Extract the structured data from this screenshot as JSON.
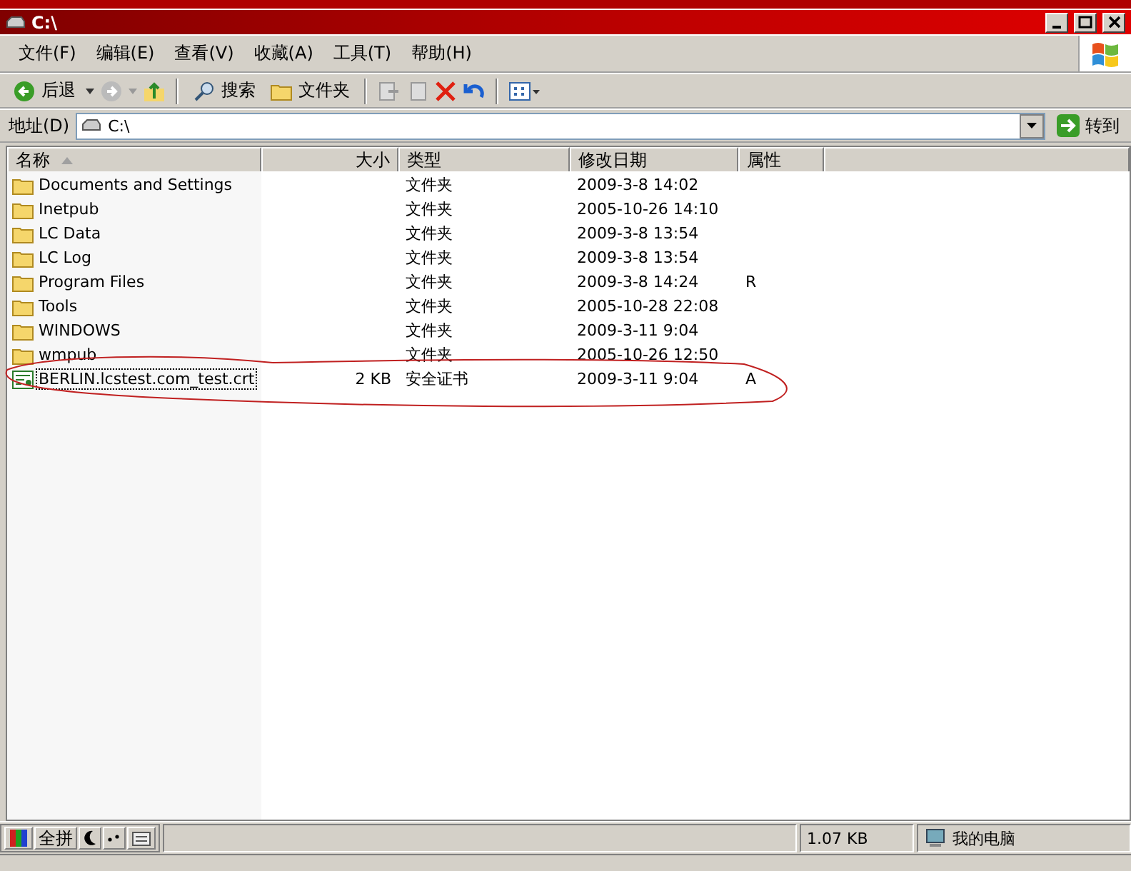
{
  "window": {
    "title": "C:\\"
  },
  "menu": [
    "文件(F)",
    "编辑(E)",
    "查看(V)",
    "收藏(A)",
    "工具(T)",
    "帮助(H)"
  ],
  "toolbar": {
    "back": "后退",
    "search": "搜索",
    "folders": "文件夹"
  },
  "address": {
    "label": "地址(D)",
    "value": "C:\\",
    "go": "转到"
  },
  "columns": [
    {
      "label": "名称",
      "sorted": true
    },
    {
      "label": "大小",
      "sorted": false
    },
    {
      "label": "类型",
      "sorted": false
    },
    {
      "label": "修改日期",
      "sorted": false
    },
    {
      "label": "属性",
      "sorted": false
    }
  ],
  "rows": [
    {
      "kind": "folder",
      "name": "Documents and Settings",
      "size": "",
      "type": "文件夹",
      "date": "2009-3-8 14:02",
      "attr": "",
      "focused": false
    },
    {
      "kind": "folder",
      "name": "Inetpub",
      "size": "",
      "type": "文件夹",
      "date": "2005-10-26 14:10",
      "attr": "",
      "focused": false
    },
    {
      "kind": "folder",
      "name": "LC Data",
      "size": "",
      "type": "文件夹",
      "date": "2009-3-8 13:54",
      "attr": "",
      "focused": false
    },
    {
      "kind": "folder",
      "name": "LC Log",
      "size": "",
      "type": "文件夹",
      "date": "2009-3-8 13:54",
      "attr": "",
      "focused": false
    },
    {
      "kind": "folder",
      "name": "Program Files",
      "size": "",
      "type": "文件夹",
      "date": "2009-3-8 14:24",
      "attr": "R",
      "focused": false
    },
    {
      "kind": "folder",
      "name": "Tools",
      "size": "",
      "type": "文件夹",
      "date": "2005-10-28 22:08",
      "attr": "",
      "focused": false
    },
    {
      "kind": "folder",
      "name": "WINDOWS",
      "size": "",
      "type": "文件夹",
      "date": "2009-3-11 9:04",
      "attr": "",
      "focused": false
    },
    {
      "kind": "folder",
      "name": "wmpub",
      "size": "",
      "type": "文件夹",
      "date": "2005-10-26 12:50",
      "attr": "",
      "focused": false
    },
    {
      "kind": "certificate",
      "name": "BERLIN.lcstest.com_test.crt",
      "size": "2 KB",
      "type": "安全证书",
      "date": "2009-3-11 9:04",
      "attr": "A",
      "focused": true,
      "circled": true
    }
  ],
  "ime": {
    "mode": "全拼"
  },
  "status": {
    "size": "1.07 KB",
    "location": "我的电脑"
  }
}
